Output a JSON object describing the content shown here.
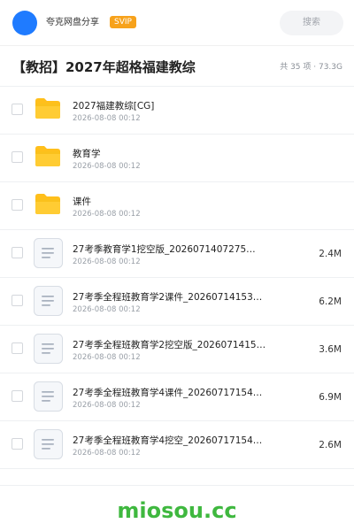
{
  "header": {
    "share_name": "夸克网盘分享",
    "badge": "SVIP",
    "search_label": "搜索",
    "accent_color": "#1f7bff",
    "badge_color": "#f7a21b"
  },
  "folder": {
    "title": "【教招】2027年超格福建教综",
    "meta": "共 35 项 · 73.3G"
  },
  "files": [
    {
      "type": "folder",
      "icon": "folder-icon",
      "name": "2027福建教综[CG]",
      "date": "2026-08-08 00:12",
      "size": ""
    },
    {
      "type": "folder",
      "icon": "folder-icon",
      "name": "教育学",
      "date": "2026-08-08 00:12",
      "size": ""
    },
    {
      "type": "folder",
      "icon": "folder-icon",
      "name": "课件",
      "date": "2026-08-08 00:12",
      "size": ""
    },
    {
      "type": "file",
      "icon": "document-icon",
      "name": "27考季教育学1挖空版_2026071407275…",
      "date": "2026-08-08 00:12",
      "size": "2.4M"
    },
    {
      "type": "file",
      "icon": "document-icon",
      "name": "27考季全程班教育学2课件_20260714153…",
      "date": "2026-08-08 00:12",
      "size": "6.2M"
    },
    {
      "type": "file",
      "icon": "document-icon",
      "name": "27考季全程班教育学2挖空版_2026071415…",
      "date": "2026-08-08 00:12",
      "size": "3.6M"
    },
    {
      "type": "file",
      "icon": "document-icon",
      "name": "27考季全程班教育学4课件_20260717154…",
      "date": "2026-08-08 00:12",
      "size": "6.9M"
    },
    {
      "type": "file",
      "icon": "document-icon",
      "name": "27考季全程班教育学4挖空_20260717154…",
      "date": "2026-08-08 00:12",
      "size": "2.6M"
    }
  ],
  "footer": {
    "watermark": "miosou.cc",
    "watermark_color": "#3fb83f"
  }
}
